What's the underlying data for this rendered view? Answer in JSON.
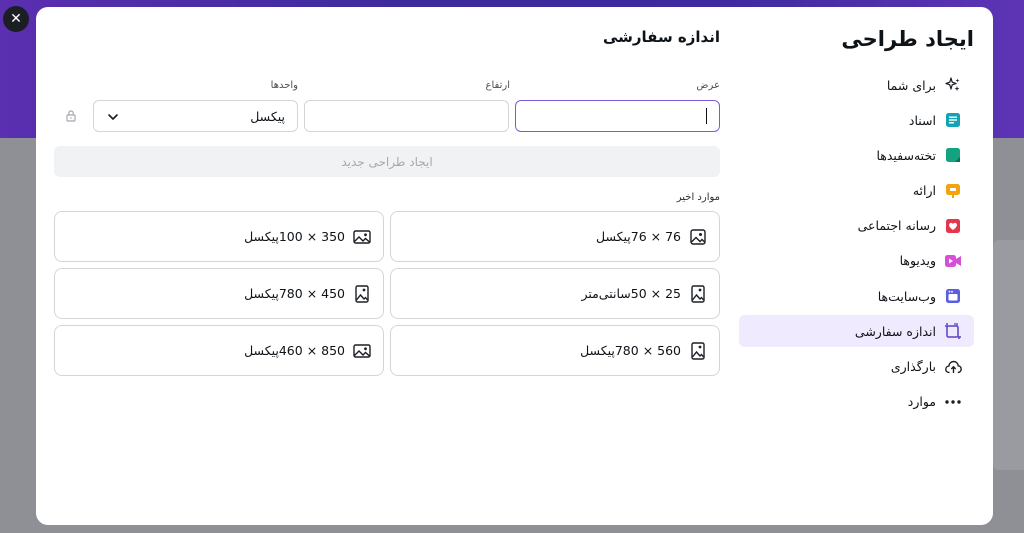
{
  "dialog": {
    "close_label": "✕"
  },
  "sidebar": {
    "title": "ایجاد طراحی",
    "items": [
      {
        "label": "برای شما",
        "icon": "sparkle-icon",
        "color": "#1b1f24"
      },
      {
        "label": "اسناد",
        "icon": "document-icon",
        "color": "#13a3b5"
      },
      {
        "label": "تخته‌سفیدها",
        "icon": "whiteboard-icon",
        "color": "#14a37f"
      },
      {
        "label": "ارائه",
        "icon": "presentation-icon",
        "color": "#f3a30f"
      },
      {
        "label": "رسانه اجتماعی",
        "icon": "heart-icon",
        "color": "#e5364f"
      },
      {
        "label": "ویدیوها",
        "icon": "video-icon",
        "color": "#d54fd8"
      },
      {
        "label": "وب‌سایت‌ها",
        "icon": "website-icon",
        "color": "#5a5fe0"
      },
      {
        "label": "اندازه سفارشی",
        "icon": "custom-size-icon",
        "color": "#5b3fc6",
        "active": true
      },
      {
        "label": "بارگذاری",
        "icon": "upload-cloud-icon",
        "color": "#1b1f24"
      },
      {
        "label": "موارد",
        "icon": "more-icon",
        "color": "#1b1f24"
      }
    ]
  },
  "main": {
    "title": "اندازه سفارشی",
    "width_label": "عرض",
    "height_label": "ارتفاع",
    "units_label": "واحدها",
    "width_value": "",
    "height_value": "",
    "units_value": "پیکسل",
    "create_button": "ایجاد طراحی جدید",
    "recent_label": "موارد اخیر",
    "recent": [
      {
        "label": "76 × 76پیکسل",
        "icon": "image-icon"
      },
      {
        "label": "350 × 100پیکسل",
        "icon": "image-icon"
      },
      {
        "label": "25 × 50سانتی‌متر",
        "icon": "portrait-image-icon"
      },
      {
        "label": "450 × 780پیکسل",
        "icon": "portrait-image-icon"
      },
      {
        "label": "560 × 780پیکسل",
        "icon": "portrait-image-icon"
      },
      {
        "label": "850 × 460پیکسل",
        "icon": "image-icon"
      }
    ]
  },
  "colors": {
    "accent": "#7b5bd6",
    "active_bg": "#efeafd"
  }
}
